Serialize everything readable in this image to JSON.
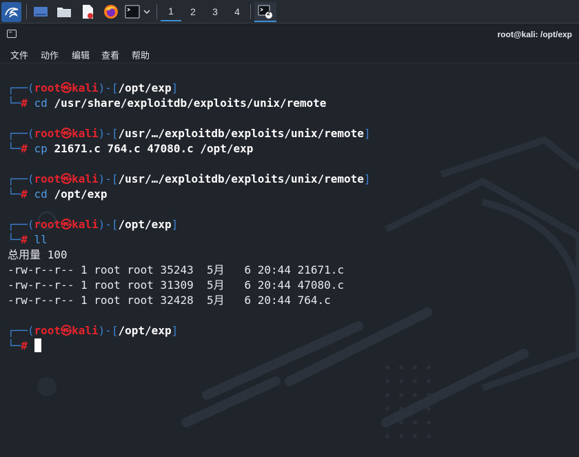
{
  "panel": {
    "workspaces": [
      "1",
      "2",
      "3",
      "4"
    ],
    "active_workspace": "1",
    "task_badge": "2",
    "icons": [
      "kali-menu-icon",
      "desktop-icon",
      "file-manager-icon",
      "text-editor-icon",
      "firefox-icon",
      "terminal-icon",
      "dropdown-chevron-icon",
      "terminal-task-icon"
    ]
  },
  "window": {
    "title": "root@kali: /opt/exp"
  },
  "menu": {
    "file": "文件",
    "action": "动作",
    "edit": "编辑",
    "view": "查看",
    "help": "帮助"
  },
  "prompt": {
    "user": "root",
    "at": "㉿",
    "host": "kali",
    "hash": "#"
  },
  "blocks": [
    {
      "path": "/opt/exp",
      "cmd": "cd",
      "args": "/usr/share/exploitdb/exploits/unix/remote"
    },
    {
      "path": "/usr/…/exploitdb/exploits/unix/remote",
      "cmd": "cp",
      "args": "21671.c 764.c 47080.c /opt/exp"
    },
    {
      "path": "/usr/…/exploitdb/exploits/unix/remote",
      "cmd": "cd",
      "args": "/opt/exp"
    },
    {
      "path": "/opt/exp",
      "cmd": "ll",
      "args": ""
    },
    {
      "path": "/opt/exp",
      "cmd": "",
      "args": ""
    }
  ],
  "output": {
    "total": "总用量 100",
    "files": [
      "-rw-r--r-- 1 root root 35243  5月   6 20:44 21671.c",
      "-rw-r--r-- 1 root root 31309  5月   6 20:44 47080.c",
      "-rw-r--r-- 1 root root 32428  5月   6 20:44 764.c"
    ]
  },
  "colors": {
    "prompt_frame": "#3d82d6",
    "prompt_user": "#e8232c",
    "command": "#4f9be6",
    "background": "#20252c"
  }
}
